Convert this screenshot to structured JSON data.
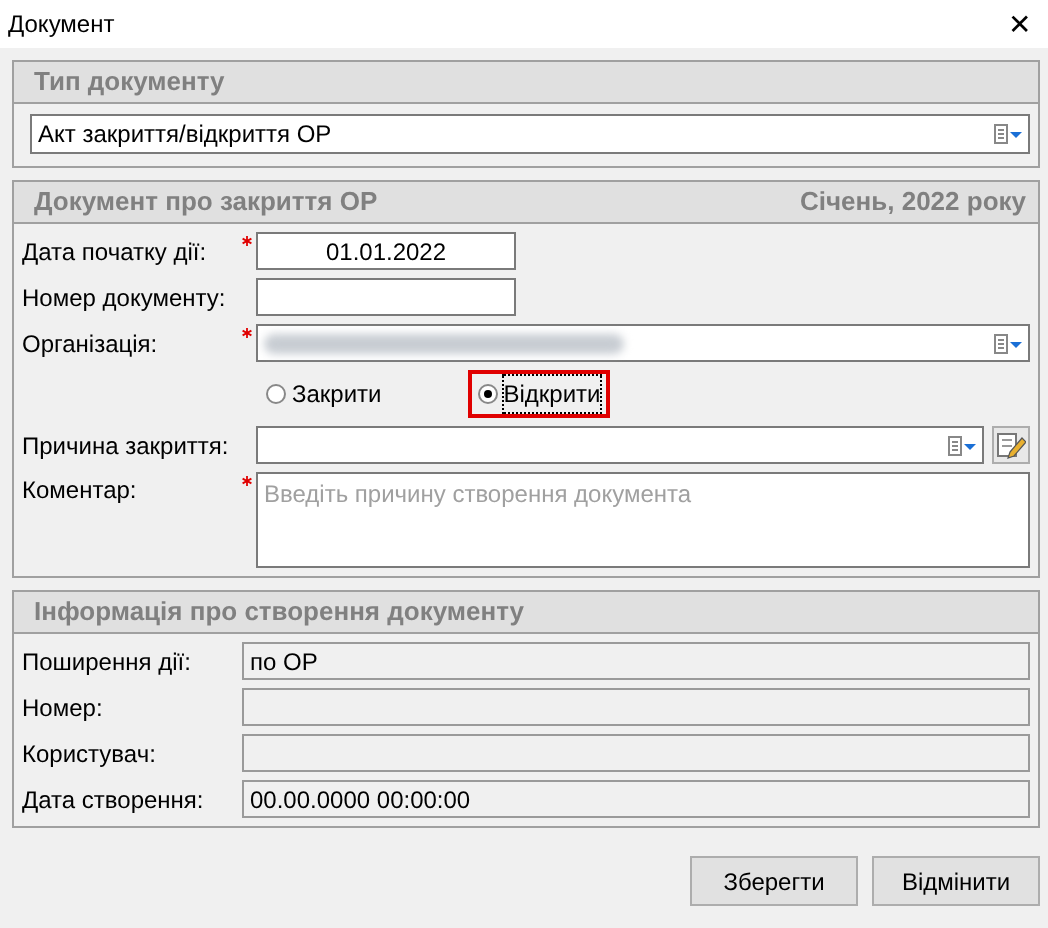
{
  "window": {
    "title": "Документ",
    "close": "✕"
  },
  "doc_type": {
    "header": "Тип документу",
    "value": "Акт закриття/відкриття ОР"
  },
  "doc_group": {
    "header": "Документ про закриття ОР",
    "period": "Січень, 2022 року",
    "fields": [
      {
        "kind": "text",
        "label": "Дата початку дії:",
        "required": true,
        "value": "01.01.2022",
        "short": true
      },
      {
        "kind": "text",
        "label": "Номер документу:",
        "required": false,
        "short": true
      },
      {
        "kind": "combo",
        "label": "Організація:",
        "required": true,
        "redacted": true
      },
      {
        "kind": "radios",
        "options": [
          {
            "label": "Закрити",
            "selected": false,
            "highlighted": false
          },
          {
            "label": "Відкрити",
            "selected": true,
            "highlighted": true
          }
        ]
      },
      {
        "kind": "combo-edit",
        "label": "Причина закриття:",
        "required": false
      },
      {
        "kind": "memo",
        "label": "Коментар:",
        "required": true,
        "placeholder": "Введіть причину створення документа"
      }
    ]
  },
  "info_group": {
    "header": "Інформація про створення документу",
    "fields": [
      {
        "label": "Поширення дії:",
        "value": "по ОР"
      },
      {
        "label": "Номер:"
      },
      {
        "label": "Користувач:"
      },
      {
        "label": "Дата створення:",
        "value": "00.00.0000 00:00:00"
      }
    ]
  },
  "buttons": [
    "Зберегти",
    "Відмінити"
  ]
}
